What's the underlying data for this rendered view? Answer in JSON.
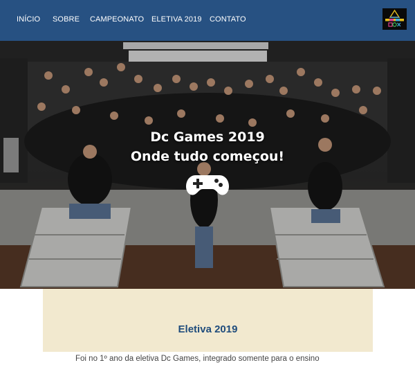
{
  "nav": {
    "items": [
      "INÍCIO",
      "SOBRE",
      "CAMPEONATO",
      "ELETIVA 2019",
      "CONTATO"
    ],
    "background": "#275182",
    "logo_text": "DC GAMES"
  },
  "hero": {
    "title_line1": "Dc Games 2019",
    "title_line2": "Onde tudo começou!",
    "icon": "gamepad-icon"
  },
  "section": {
    "title": "Eletiva 2019",
    "text": "Foi no 1º ano da eletiva Dc Games, integrado somente para o ensino",
    "background": "#f2e9cf",
    "title_color": "#1f4c7c"
  }
}
